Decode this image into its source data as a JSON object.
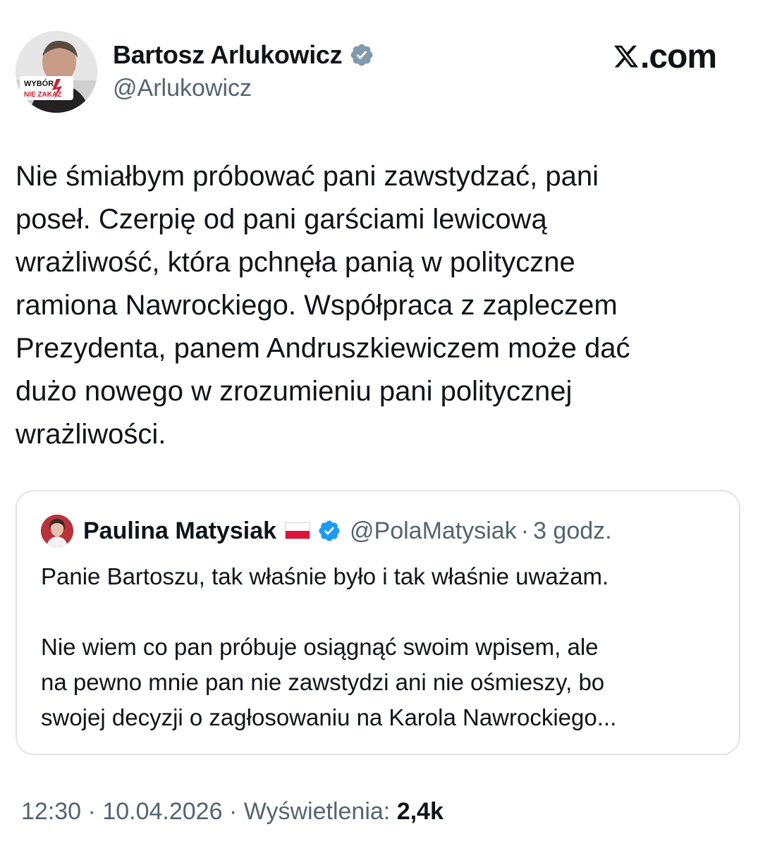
{
  "author": {
    "name": "Bartosz Arlukowicz",
    "handle": "@Arlukowicz",
    "avatar_badge_top": "WYBÓR",
    "avatar_badge_bottom": "NIE ZAKAZ"
  },
  "site": {
    "logo_text": ".com",
    "icon": "x-logo-icon"
  },
  "tweet": {
    "text_lines": [
      "Nie śmiałbym próbować pani zawstydzać, pani",
      "poseł. Czerpię od pani garściami lewicową",
      "wrażliwość, która pchnęła panią w polityczne",
      "ramiona Nawrockiego. Współpraca z zapleczem",
      "Prezydenta, panem Andruszkiewiczem może dać",
      "dużo nowego w zrozumieniu pani politycznej",
      "wrażliwości."
    ]
  },
  "quote": {
    "name": "Paulina Matysiak",
    "handle": "@PolaMatysiak",
    "separator": "·",
    "time": "3 godz.",
    "paragraph1": "Panie Bartoszu, tak właśnie było i tak właśnie uważam.",
    "paragraph2_lines": [
      "Nie wiem co pan próbuje osiągnąć swoim wpisem, ale",
      "na pewno mnie pan nie zawstydzi ani nie ośmieszy, bo",
      "swojej decyzji o zagłosowaniu na Karola Nawrockiego..."
    ]
  },
  "meta": {
    "time": "12:30",
    "sep1": " · ",
    "date": "10.04.2026",
    "sep2": " · ",
    "views_label": "Wyświetlenia: ",
    "views_count": "2,4k"
  },
  "colors": {
    "verified_blue": "#1d9bf0",
    "secondary_text": "#536471",
    "primary_text": "#0f1419",
    "card_border": "#dfe3e6"
  }
}
